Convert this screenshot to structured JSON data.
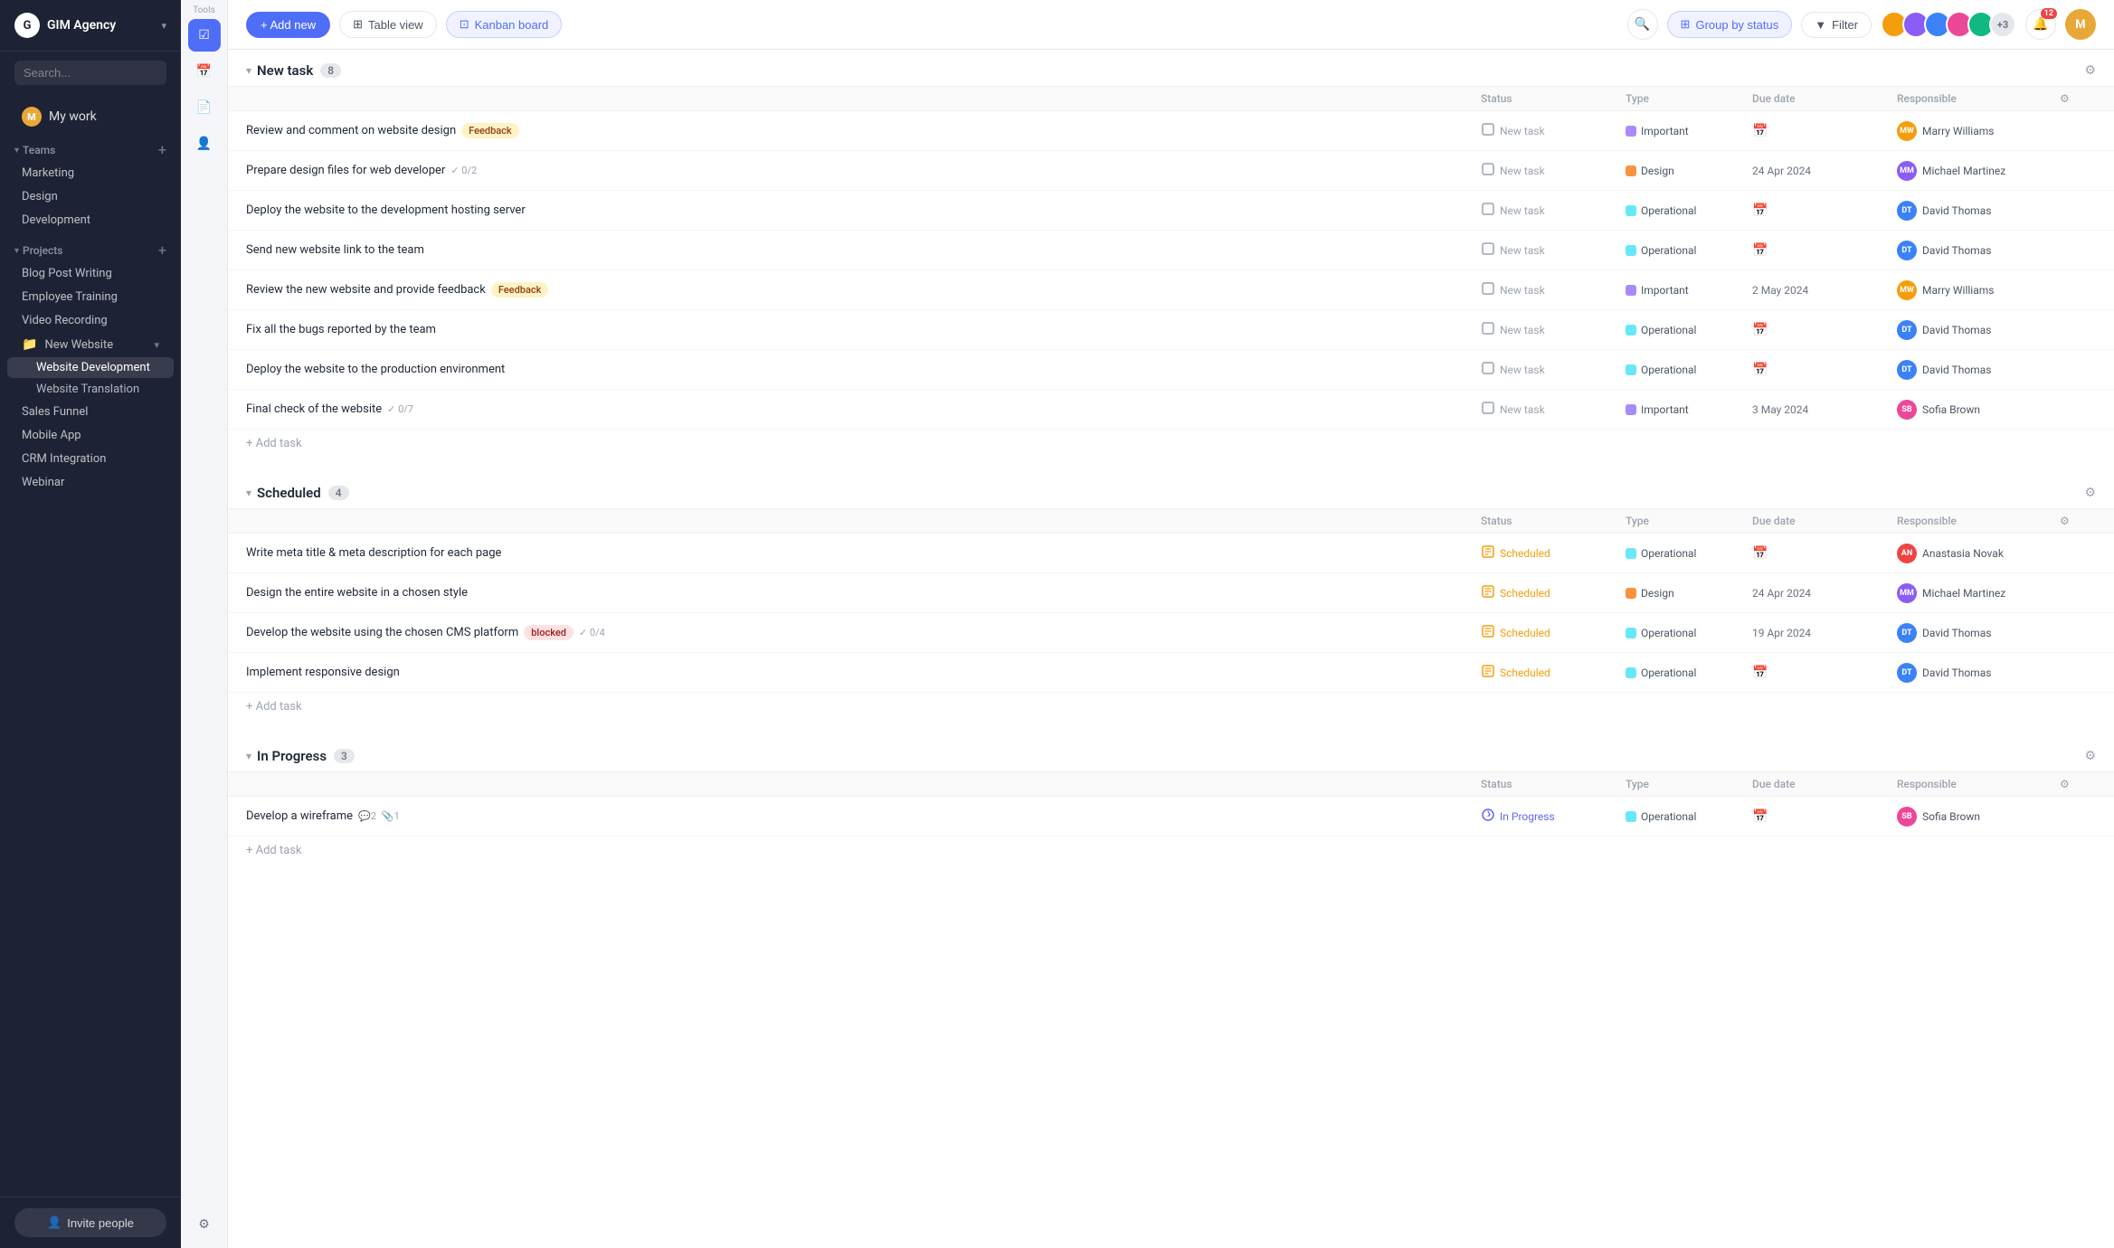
{
  "app": {
    "name": "GIM Agency",
    "logo_letter": "G"
  },
  "sidebar": {
    "search_placeholder": "Search...",
    "my_work_label": "My work",
    "teams_label": "Teams",
    "teams": [
      {
        "label": "Marketing"
      },
      {
        "label": "Design"
      },
      {
        "label": "Development"
      }
    ],
    "projects_label": "Projects",
    "projects": [
      {
        "label": "Blog Post Writing",
        "active": false
      },
      {
        "label": "Employee Training",
        "active": false
      },
      {
        "label": "Video Recording",
        "active": false
      },
      {
        "label": "New Website",
        "active": true,
        "has_folder": true,
        "sub_items": [
          {
            "label": "Website Development",
            "active": true
          },
          {
            "label": "Website Translation",
            "active": false
          }
        ]
      },
      {
        "label": "Sales Funnel",
        "active": false
      },
      {
        "label": "Mobile App",
        "active": false
      },
      {
        "label": "CRM Integration",
        "active": false
      },
      {
        "label": "Webinar",
        "active": false
      }
    ],
    "invite_label": "Invite people"
  },
  "toolbar": {
    "title": "Tools",
    "add_new_label": "+ Add new",
    "table_view_label": "Table view",
    "kanban_board_label": "Kanban board",
    "group_by_status_label": "Group by status",
    "filter_label": "Filter",
    "avatars_more": "+3",
    "notification_count": "12"
  },
  "groups": [
    {
      "title": "New task",
      "count": "8",
      "columns": {
        "status": "Status",
        "type": "Type",
        "due_date": "Due date",
        "responsible": "Responsible"
      },
      "tasks": [
        {
          "name": "Review and comment on website design",
          "tag": "Feedback",
          "tag_class": "tag-feedback",
          "status": "New task",
          "status_icon": "✉️",
          "status_class": "status-new",
          "type": "Important",
          "type_dot": "dot-important",
          "due_date": "",
          "responsible_name": "Marry Williams",
          "resp_color": "av-orange"
        },
        {
          "name": "Prepare design files for web developer",
          "subtask": "0/2",
          "status": "New task",
          "status_icon": "✉️",
          "status_class": "status-new",
          "type": "Design",
          "type_dot": "dot-design",
          "due_date": "24 Apr 2024",
          "responsible_name": "Michael Martinez",
          "resp_color": "av-purple"
        },
        {
          "name": "Deploy the website to the development hosting server",
          "status": "New task",
          "status_icon": "✉️",
          "status_class": "status-new",
          "type": "Operational",
          "type_dot": "dot-operational",
          "due_date": "",
          "responsible_name": "David Thomas",
          "resp_color": "av-blue"
        },
        {
          "name": "Send new website link to the team",
          "status": "New task",
          "status_icon": "✉️",
          "status_class": "status-new",
          "type": "Operational",
          "type_dot": "dot-operational",
          "due_date": "",
          "responsible_name": "David Thomas",
          "resp_color": "av-blue"
        },
        {
          "name": "Review the new website and provide feedback",
          "tag": "Feedback",
          "tag_class": "tag-feedback",
          "status": "New task",
          "status_icon": "✉️",
          "status_class": "status-new",
          "type": "Important",
          "type_dot": "dot-important",
          "due_date": "2 May 2024",
          "responsible_name": "Marry Williams",
          "resp_color": "av-orange"
        },
        {
          "name": "Fix all the bugs reported by the team",
          "status": "New task",
          "status_icon": "✉️",
          "status_class": "status-new",
          "type": "Operational",
          "type_dot": "dot-operational",
          "due_date": "",
          "responsible_name": "David Thomas",
          "resp_color": "av-blue"
        },
        {
          "name": "Deploy the website to the production environment",
          "status": "New task",
          "status_icon": "✉️",
          "status_class": "status-new",
          "type": "Operational",
          "type_dot": "dot-operational",
          "due_date": "",
          "responsible_name": "David Thomas",
          "resp_color": "av-blue"
        },
        {
          "name": "Final check of the website",
          "subtask": "0/7",
          "status": "New task",
          "status_icon": "✉️",
          "status_class": "status-new",
          "type": "Important",
          "type_dot": "dot-important",
          "due_date": "3 May 2024",
          "responsible_name": "Sofia Brown",
          "resp_color": "av-pink"
        }
      ],
      "add_task_label": "+ Add task"
    },
    {
      "title": "Scheduled",
      "count": "4",
      "columns": {
        "status": "Status",
        "type": "Type",
        "due_date": "Due date",
        "responsible": "Responsible"
      },
      "tasks": [
        {
          "name": "Write meta title & meta description for each page",
          "status": "Scheduled",
          "status_icon": "📅",
          "status_class": "status-scheduled",
          "type": "Operational",
          "type_dot": "dot-operational",
          "due_date": "",
          "responsible_name": "Anastasia Novak",
          "resp_color": "av-red"
        },
        {
          "name": "Design the entire website in a chosen style",
          "status": "Scheduled",
          "status_icon": "📅",
          "status_class": "status-scheduled",
          "type": "Design",
          "type_dot": "dot-design",
          "due_date": "24 Apr 2024",
          "responsible_name": "Michael Martinez",
          "resp_color": "av-purple"
        },
        {
          "name": "Develop the website using the chosen CMS platform",
          "tag": "blocked",
          "tag_class": "tag-blocked",
          "subtask": "0/4",
          "status": "Scheduled",
          "status_icon": "📅",
          "status_class": "status-scheduled",
          "type": "Operational",
          "type_dot": "dot-operational",
          "due_date": "19 Apr 2024",
          "responsible_name": "David Thomas",
          "resp_color": "av-blue"
        },
        {
          "name": "Implement responsive design",
          "status": "Scheduled",
          "status_icon": "📅",
          "status_class": "status-scheduled",
          "type": "Operational",
          "type_dot": "dot-operational",
          "due_date": "",
          "responsible_name": "David Thomas",
          "resp_color": "av-blue"
        }
      ],
      "add_task_label": "+ Add task"
    },
    {
      "title": "In Progress",
      "count": "3",
      "columns": {
        "status": "Status",
        "type": "Type",
        "due_date": "Due date",
        "responsible": "Responsible"
      },
      "tasks": [
        {
          "name": "Develop a wireframe",
          "comments": "2",
          "attachments": "1",
          "status": "In Progress",
          "status_icon": "🚀",
          "status_class": "status-inprogress",
          "type": "Operational",
          "type_dot": "dot-operational",
          "due_date": "",
          "responsible_name": "Sofia Brown",
          "resp_color": "av-pink"
        }
      ],
      "add_task_label": "+ Add task"
    }
  ]
}
